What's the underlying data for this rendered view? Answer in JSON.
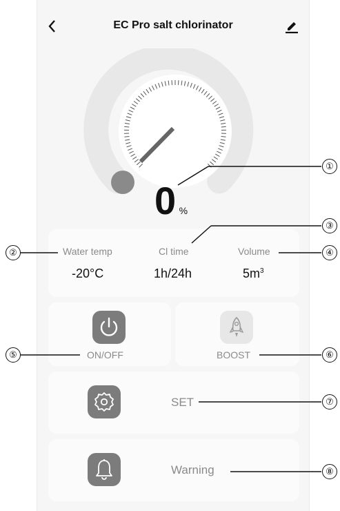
{
  "header": {
    "title": "EC Pro salt chlorinator",
    "back_icon": "chevron-left-icon",
    "edit_icon": "pencil-icon"
  },
  "gauge": {
    "value": "0",
    "unit": "%",
    "level": 0
  },
  "stats": [
    {
      "label": "Water temp",
      "value": "-20°C"
    },
    {
      "label": "Cl time",
      "value": "1h/24h"
    },
    {
      "label": "Volume",
      "value": "5m",
      "value_sup": "3"
    }
  ],
  "controls": {
    "onoff_label": "ON/OFF",
    "boost_label": "BOOST",
    "set_label": "SET",
    "warning_label": "Warning"
  },
  "callouts": [
    "①",
    "②",
    "③",
    "④",
    "⑤",
    "⑥",
    "⑦",
    "⑧"
  ],
  "colors": {
    "icon_dark": "#7c7c7c",
    "gauge_track": "#e8e8e8",
    "needle": "#666666"
  }
}
